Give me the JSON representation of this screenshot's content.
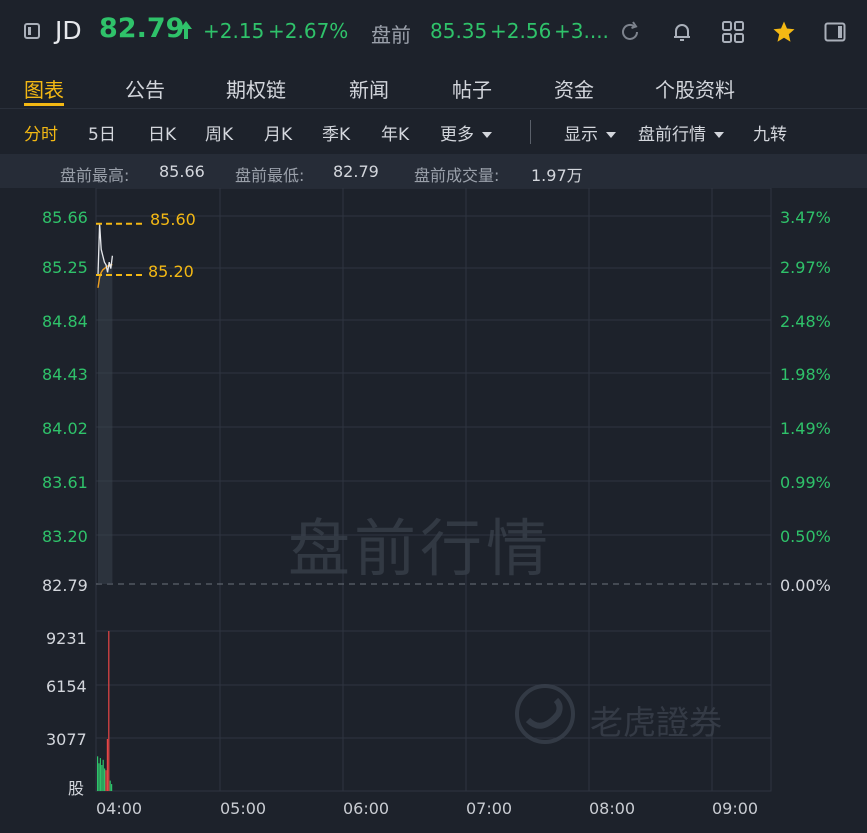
{
  "header": {
    "ticker": "JD",
    "price": "82.79",
    "change": "+2.15",
    "change_pct": "+2.67%",
    "premarket_label": "盘前",
    "premarket_price": "85.35",
    "premarket_change": "+2.56",
    "premarket_pct": "+3....",
    "icons": [
      "panel-left-icon",
      "refresh-icon",
      "bell-icon",
      "grid-icon",
      "star-icon",
      "panel-right-icon"
    ],
    "colors": {
      "up": "#2fc26a",
      "accent": "#f3b814"
    }
  },
  "tabs": [
    {
      "label": "图表",
      "active": true
    },
    {
      "label": "公告"
    },
    {
      "label": "期权链"
    },
    {
      "label": "新闻"
    },
    {
      "label": "帖子"
    },
    {
      "label": "资金"
    },
    {
      "label": "个股资料"
    }
  ],
  "periods": {
    "items": [
      "分时",
      "5日",
      "日K",
      "周K",
      "月K",
      "季K",
      "年K"
    ],
    "more": "更多",
    "display": "显示",
    "premarket": "盘前行情",
    "nine": "九转"
  },
  "info": {
    "high_label": "盘前最高:",
    "high": "85.66",
    "low_label": "盘前最低:",
    "low": "82.79",
    "vol_label": "盘前成交量:",
    "vol": "1.97万"
  },
  "watermark": "盘前行情",
  "brand": "老虎證券",
  "chart_data": {
    "type": "line",
    "price_axis": [
      "85.66",
      "85.25",
      "84.84",
      "84.43",
      "84.02",
      "83.61",
      "83.20",
      "82.79"
    ],
    "pct_axis": [
      "3.47%",
      "2.97%",
      "2.48%",
      "1.98%",
      "1.49%",
      "0.99%",
      "0.50%",
      "0.00%"
    ],
    "volume_axis": [
      "9231",
      "6154",
      "3077",
      "股"
    ],
    "time_axis": [
      "04:00",
      "05:00",
      "06:00",
      "07:00",
      "08:00",
      "09:00"
    ],
    "ylim": [
      82.79,
      85.66
    ],
    "baseline": 82.79,
    "levels": [
      {
        "label": "85.60",
        "value": 85.6
      },
      {
        "label": "85.20",
        "value": 85.2
      }
    ],
    "price_series": [
      85.2,
      85.6,
      85.4,
      85.35,
      85.3,
      85.28,
      85.22,
      85.3,
      85.25,
      85.35
    ],
    "avg_series": [
      85.1,
      85.18,
      85.22,
      85.24,
      85.25,
      85.26,
      85.27,
      85.27,
      85.28,
      85.28
    ],
    "volume_series": [
      {
        "v": 2000,
        "up": true
      },
      {
        "v": 1600,
        "up": true
      },
      {
        "v": 1900,
        "up": true
      },
      {
        "v": 1500,
        "up": true
      },
      {
        "v": 1800,
        "up": true
      },
      {
        "v": 1300,
        "up": true
      },
      {
        "v": 1200,
        "up": false
      },
      {
        "v": 3000,
        "up": false
      },
      {
        "v": 9231,
        "up": false
      },
      {
        "v": 600,
        "up": true
      },
      {
        "v": 400,
        "up": true
      }
    ]
  }
}
